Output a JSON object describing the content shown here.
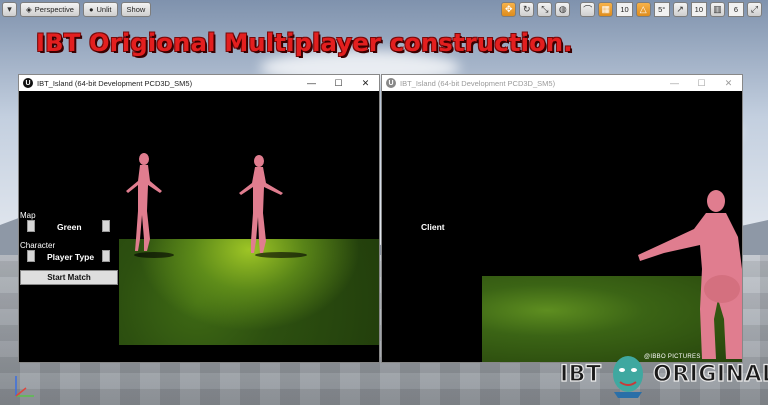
{
  "editor": {
    "viewport_mode": "Perspective",
    "lighting_mode": "Unlit",
    "show_label": "Show",
    "grid_snap_value": "10",
    "rotation_snap_value": "5°",
    "scale_snap_value": "10",
    "camera_speed": "6"
  },
  "headline": "IBT Origional Multiplayer construction.",
  "windows": [
    {
      "title": "IBT_Island (64-bit Development PCD3D_SM5)",
      "controls": {
        "minimize": "—",
        "maximize": "☐",
        "close": "✕"
      },
      "ui": {
        "map_label": "Map",
        "map_value": "Green",
        "character_label": "Character",
        "character_value": "Player Type",
        "start_button": "Start Match"
      }
    },
    {
      "title": "IBT_Island (64-bit Development PCD3D_SM5)",
      "controls": {
        "minimize": "—",
        "maximize": "☐",
        "close": "✕"
      },
      "client_label": "Client"
    }
  ],
  "brand": {
    "left_text": "IBT",
    "right_text": "ORIGINAL",
    "small_text": "@IBBO PICTURES"
  },
  "colors": {
    "headline": "#e31f1f",
    "snap_active": "#de8c1c",
    "character": "#e07d8f"
  }
}
